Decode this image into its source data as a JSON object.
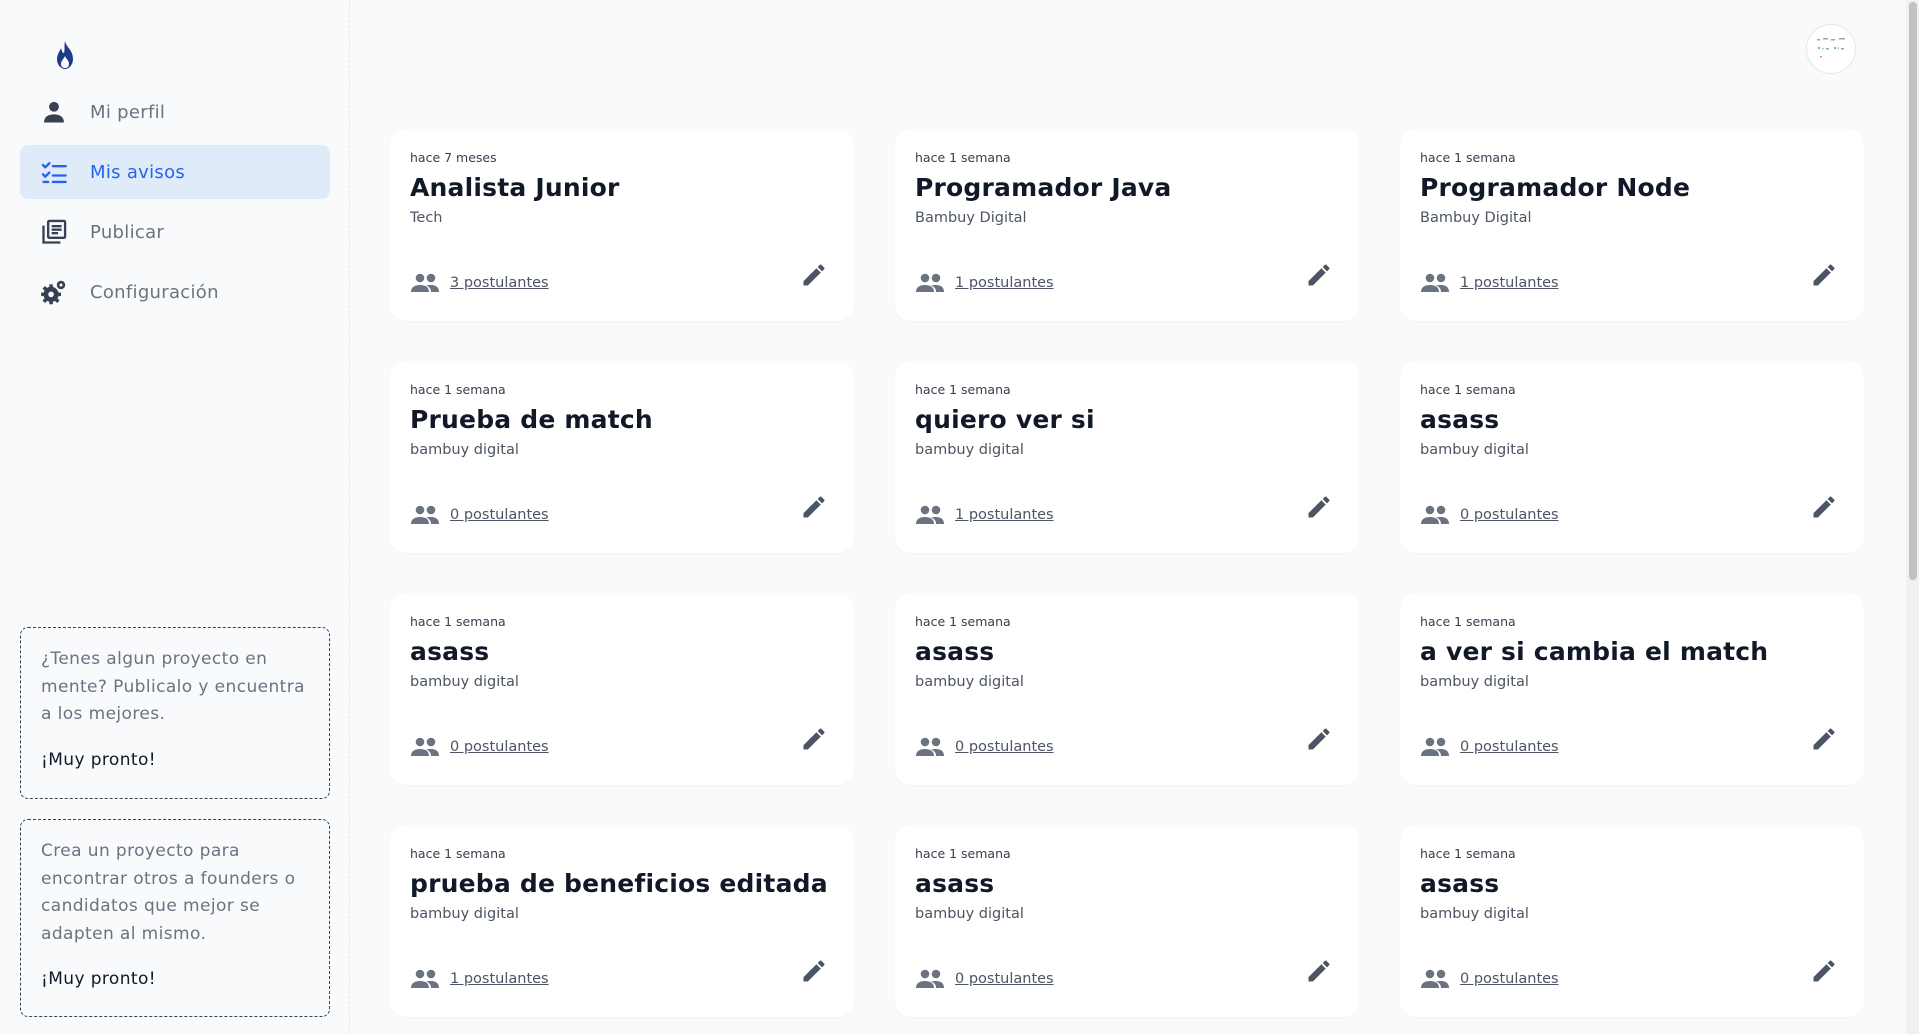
{
  "sidebar": {
    "logo_icon": "flame-icon",
    "items": [
      {
        "label": "Mi perfil",
        "icon": "person-icon",
        "active": false
      },
      {
        "label": "Mis avisos",
        "icon": "checklist-icon",
        "active": true
      },
      {
        "label": "Publicar",
        "icon": "library-books-icon",
        "active": false
      },
      {
        "label": "Configuración",
        "icon": "settings-gears-icon",
        "active": false
      }
    ],
    "promo1": {
      "text": "¿Tenes algun proyecto en mente? Publicalo y encuentra a los mejores.",
      "soon": "¡Muy pronto!"
    },
    "promo2": {
      "text": "Crea un proyecto para encontrar otros a founders o candidatos que mejor se adapten al mismo.",
      "soon": "¡Muy pronto!"
    }
  },
  "colors": {
    "accent": "#2563eb",
    "active_bg": "#e0ebfa",
    "logo": "#1e3a8a"
  },
  "cards": [
    {
      "time": "hace 7 meses",
      "title": "Analista Junior",
      "company": "Tech",
      "applicants": "3 postulantes"
    },
    {
      "time": "hace 1 semana",
      "title": "Programador Java",
      "company": "Bambuy Digital",
      "applicants": "1 postulantes"
    },
    {
      "time": "hace 1 semana",
      "title": "Programador Node",
      "company": "Bambuy Digital",
      "applicants": "1 postulantes"
    },
    {
      "time": "hace 1 semana",
      "title": "Prueba de match",
      "company": "bambuy digital",
      "applicants": "0 postulantes"
    },
    {
      "time": "hace 1 semana",
      "title": "quiero ver si",
      "company": "bambuy digital",
      "applicants": "1 postulantes"
    },
    {
      "time": "hace 1 semana",
      "title": "asass",
      "company": "bambuy digital",
      "applicants": "0 postulantes"
    },
    {
      "time": "hace 1 semana",
      "title": "asass",
      "company": "bambuy digital",
      "applicants": "0 postulantes"
    },
    {
      "time": "hace 1 semana",
      "title": "asass",
      "company": "bambuy digital",
      "applicants": "0 postulantes"
    },
    {
      "time": "hace 1 semana",
      "title": "a ver si cambia el match",
      "company": "bambuy digital",
      "applicants": "0 postulantes"
    },
    {
      "time": "hace 1 semana",
      "title": "prueba de beneficios editada",
      "company": "bambuy digital",
      "applicants": "1 postulantes"
    },
    {
      "time": "hace 1 semana",
      "title": "asass",
      "company": "bambuy digital",
      "applicants": "0 postulantes"
    },
    {
      "time": "hace 1 semana",
      "title": "asass",
      "company": "bambuy digital",
      "applicants": "0 postulantes"
    }
  ]
}
